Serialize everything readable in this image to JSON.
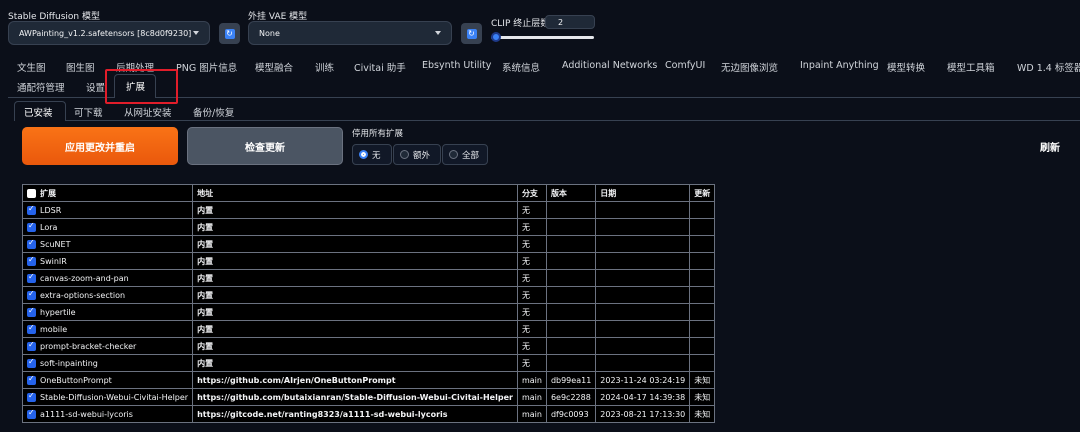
{
  "models": {
    "sd_label": "Stable Diffusion 模型",
    "sd_value": "AWPainting_v1.2.safetensors [8c8d0f9230]",
    "vae_label": "外挂 VAE 模型",
    "vae_value": "None",
    "clip_label": "CLIP 终止层数",
    "clip_value": "2",
    "clip_min": 1,
    "clip_max": 12
  },
  "tabs_row1": [
    "文生图",
    "图生图",
    "后期处理",
    "PNG 图片信息",
    "模型融合",
    "训练",
    "Civitai 助手",
    "Ebsynth Utility",
    "系统信息",
    "Additional Networks",
    "ComfyUI",
    "无边图像浏览",
    "Inpaint Anything",
    "模型转换",
    "模型工具箱",
    "WD 1.4 标签器"
  ],
  "tabs_row2": [
    "通配符管理",
    "设置",
    "扩展"
  ],
  "active_tab": "扩展",
  "subtabs": [
    "已安装",
    "可下载",
    "从网址安装",
    "备份/恢复"
  ],
  "active_subtab": "已安装",
  "actions": {
    "apply_label": "应用更改并重启",
    "check_label": "检查更新",
    "disable_label": "停用所有扩展",
    "options": [
      "无",
      "额外",
      "全部"
    ],
    "selected_option": "无",
    "refresh_label": "刷新"
  },
  "table": {
    "headers": [
      "扩展",
      "地址",
      "分支",
      "版本",
      "日期",
      "更新"
    ],
    "rows": [
      {
        "name": "LDSR",
        "url": "内置",
        "branch": "无",
        "version": "",
        "date": "",
        "update": "",
        "enabled": true
      },
      {
        "name": "Lora",
        "url": "内置",
        "branch": "无",
        "version": "",
        "date": "",
        "update": "",
        "enabled": true
      },
      {
        "name": "ScuNET",
        "url": "内置",
        "branch": "无",
        "version": "",
        "date": "",
        "update": "",
        "enabled": true
      },
      {
        "name": "SwinIR",
        "url": "内置",
        "branch": "无",
        "version": "",
        "date": "",
        "update": "",
        "enabled": true
      },
      {
        "name": "canvas-zoom-and-pan",
        "url": "内置",
        "branch": "无",
        "version": "",
        "date": "",
        "update": "",
        "enabled": true
      },
      {
        "name": "extra-options-section",
        "url": "内置",
        "branch": "无",
        "version": "",
        "date": "",
        "update": "",
        "enabled": true
      },
      {
        "name": "hypertile",
        "url": "内置",
        "branch": "无",
        "version": "",
        "date": "",
        "update": "",
        "enabled": true
      },
      {
        "name": "mobile",
        "url": "内置",
        "branch": "无",
        "version": "",
        "date": "",
        "update": "",
        "enabled": true
      },
      {
        "name": "prompt-bracket-checker",
        "url": "内置",
        "branch": "无",
        "version": "",
        "date": "",
        "update": "",
        "enabled": true
      },
      {
        "name": "soft-inpainting",
        "url": "内置",
        "branch": "无",
        "version": "",
        "date": "",
        "update": "",
        "enabled": true
      },
      {
        "name": "OneButtonPrompt",
        "url": "https://github.com/AIrjen/OneButtonPrompt",
        "branch": "main",
        "version": "db99ea11",
        "date": "2023-11-24 03:24:19",
        "update": "未知",
        "enabled": true
      },
      {
        "name": "Stable-Diffusion-Webui-Civitai-Helper",
        "url": "https://github.com/butaixianran/Stable-Diffusion-Webui-Civitai-Helper",
        "branch": "main",
        "version": "6e9c2288",
        "date": "2024-04-17 14:39:38",
        "update": "未知",
        "enabled": true
      },
      {
        "name": "a1111-sd-webui-lycoris",
        "url": "https://gitcode.net/ranting8323/a1111-sd-webui-lycoris",
        "branch": "main",
        "version": "df9c0093",
        "date": "2023-08-21 17:13:30",
        "update": "未知",
        "enabled": true
      }
    ]
  },
  "colors": {
    "background": "#0b0f19",
    "accent": "#3b82f6",
    "orange": "#f97316",
    "highlight_box": "#e11d2a"
  }
}
